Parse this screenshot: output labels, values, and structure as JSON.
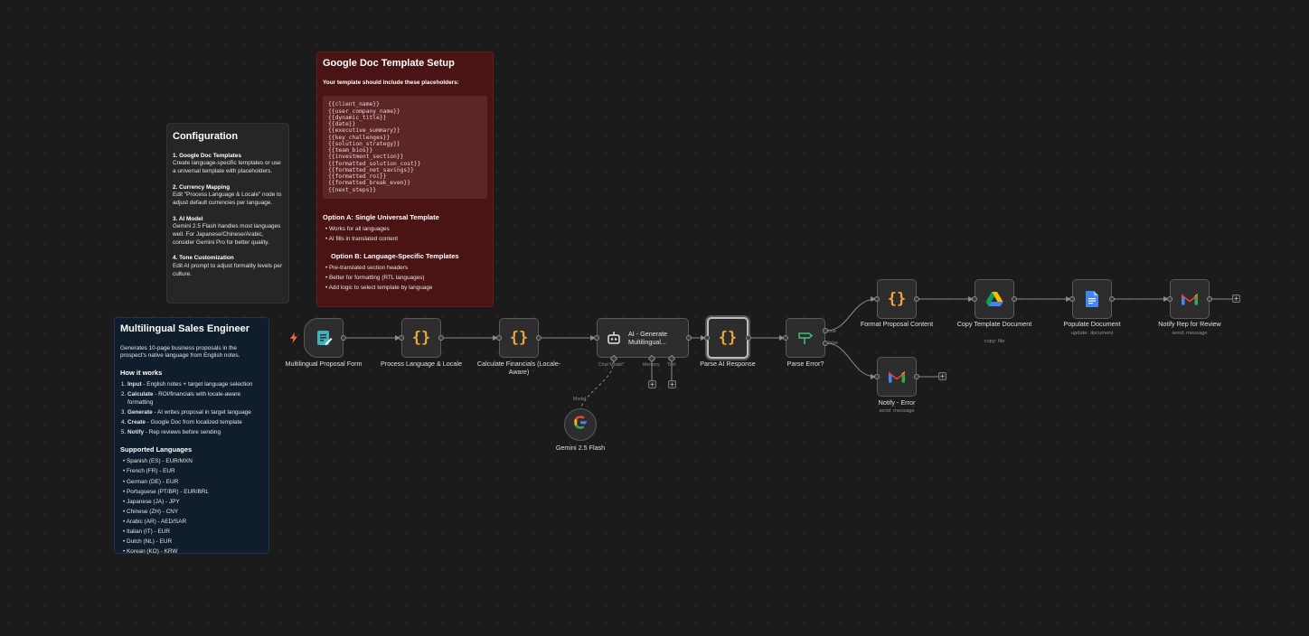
{
  "notes": {
    "configuration": {
      "title": "Configuration",
      "sections": [
        {
          "heading": "1. Google Doc Templates",
          "body": "Create language-specific templates or use a universal template with placeholders."
        },
        {
          "heading": "2. Currency Mapping",
          "body": "Edit \"Process Language & Locale\" node to adjust default currencies per language."
        },
        {
          "heading": "3. AI Model",
          "body": "Gemini 2.5 Flash handles most languages well. For Japanese/Chinese/Arabic, consider Gemini Pro for better quality."
        },
        {
          "heading": "4. Tone Customization",
          "body": "Edit AI prompt to adjust formality levels per culture."
        }
      ]
    },
    "google_doc": {
      "title": "Google Doc Template Setup",
      "intro": "Your template should include these placeholders:",
      "placeholders": "{{client_name}}\n{{user_company_name}}\n{{dynamic_title}}\n{{date}}\n{{executive_summary}}\n{{key_challenges}}\n{{solution_strategy}}\n{{team_bios}}\n{{investment_section}}\n{{formatted_solution_cost}}\n{{formatted_net_savings}}\n{{formatted_roi}}\n{{formatted_break_even}}\n{{next_steps}}",
      "option_a": {
        "title": "Option A: Single Universal Template",
        "items": [
          "Works for all languages",
          "AI fills in translated content"
        ]
      },
      "option_b": {
        "title": "Option B: Language-Specific Templates",
        "items": [
          "Pre-translated section headers",
          "Better for formatting (RTL languages)",
          "Add logic to select template by language"
        ]
      }
    },
    "sales_engineer": {
      "title": "Multilingual Sales Engineer",
      "description": "Generates 10-page business proposals in the prospect's native language from English notes.",
      "how_title": "How it works",
      "steps": [
        {
          "b": "Input",
          "t": " - English notes + target language selection"
        },
        {
          "b": "Calculate",
          "t": " - ROI/financials with locale-aware formatting"
        },
        {
          "b": "Generate",
          "t": " - AI writes proposal in target language"
        },
        {
          "b": "Create",
          "t": " - Google Doc from localized template"
        },
        {
          "b": "Notify",
          "t": " - Rep reviews before sending"
        }
      ],
      "languages_title": "Supported Languages",
      "languages": [
        "Spanish (ES) - EUR/MXN",
        "French (FR) - EUR",
        "German (DE) - EUR",
        "Portuguese (PT/BR) - EUR/BRL",
        "Japanese (JA) - JPY",
        "Chinese (ZH) - CNY",
        "Arabic (AR) - AED/SAR",
        "Italian (IT) - EUR",
        "Dutch (NL) - EUR",
        "Korean (KO) - KRW"
      ]
    }
  },
  "nodes": {
    "form": {
      "label": "Multilingual Proposal Form",
      "icon": "form-icon"
    },
    "process": {
      "label": "Process Language & Locale",
      "icon": "code-braces-icon"
    },
    "calc": {
      "label": "Calculate Financials (Locale-Aware)",
      "icon": "code-braces-icon"
    },
    "agent": {
      "label": "AI - Generate Multilingual...",
      "icon": "robot-icon",
      "ports": {
        "chat_model": "Chat Model*",
        "memory": "Memory",
        "tool": "Tool"
      }
    },
    "parse": {
      "label": "Parse AI Response",
      "icon": "code-braces-icon"
    },
    "if": {
      "label": "Parse Error?",
      "icon": "if-signpost-icon",
      "true_label": "true",
      "false_label": "false"
    },
    "format": {
      "label": "Format Proposal Content",
      "icon": "code-braces-icon"
    },
    "copy": {
      "label": "Copy Template Document",
      "sub": "copy: file",
      "icon": "google-drive-icon"
    },
    "populate": {
      "label": "Populate Document",
      "sub": "update: document",
      "icon": "google-docs-icon"
    },
    "notify_rep": {
      "label": "Notify Rep for Review",
      "sub": "send: message",
      "icon": "gmail-icon"
    },
    "notify_err": {
      "label": "Notify - Error",
      "sub": "send: message",
      "icon": "gmail-icon"
    },
    "gemini": {
      "label": "Gemini 2.5 Flash",
      "port": "Model",
      "icon": "google-g-icon"
    }
  },
  "colors": {
    "canvas": "#1b1b1b",
    "config_note": "#262626",
    "gdoc_note": "#4a1414",
    "info_note": "#0f1d2c",
    "code_icon": "#f0a43c"
  }
}
